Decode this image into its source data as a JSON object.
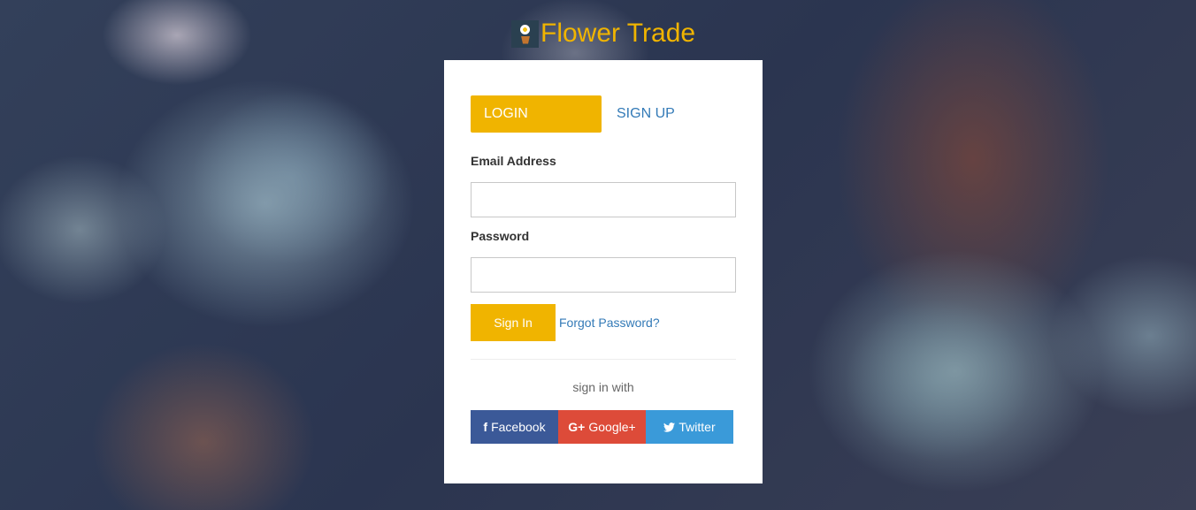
{
  "brand": {
    "title": "Flower Trade",
    "logo_icon": "flower-pot-icon"
  },
  "tabs": {
    "login": "LOGIN",
    "signup": "SIGN UP",
    "active": "login"
  },
  "form": {
    "email_label": "Email Address",
    "email_value": "",
    "password_label": "Password",
    "password_value": "",
    "signin_label": "Sign In",
    "forgot_label": "Forgot Password?"
  },
  "social": {
    "heading": "sign in with",
    "buttons": [
      {
        "label": "Facebook",
        "icon": "facebook-icon",
        "glyph": "f",
        "color": "#3b5998"
      },
      {
        "label": "Google+",
        "icon": "google-plus-icon",
        "glyph": "G+",
        "color": "#dd4b39"
      },
      {
        "label": "Twitter",
        "icon": "twitter-icon",
        "glyph": "",
        "color": "#3a9ad9"
      }
    ]
  },
  "colors": {
    "accent": "#f0b400",
    "link": "#337ab7"
  }
}
